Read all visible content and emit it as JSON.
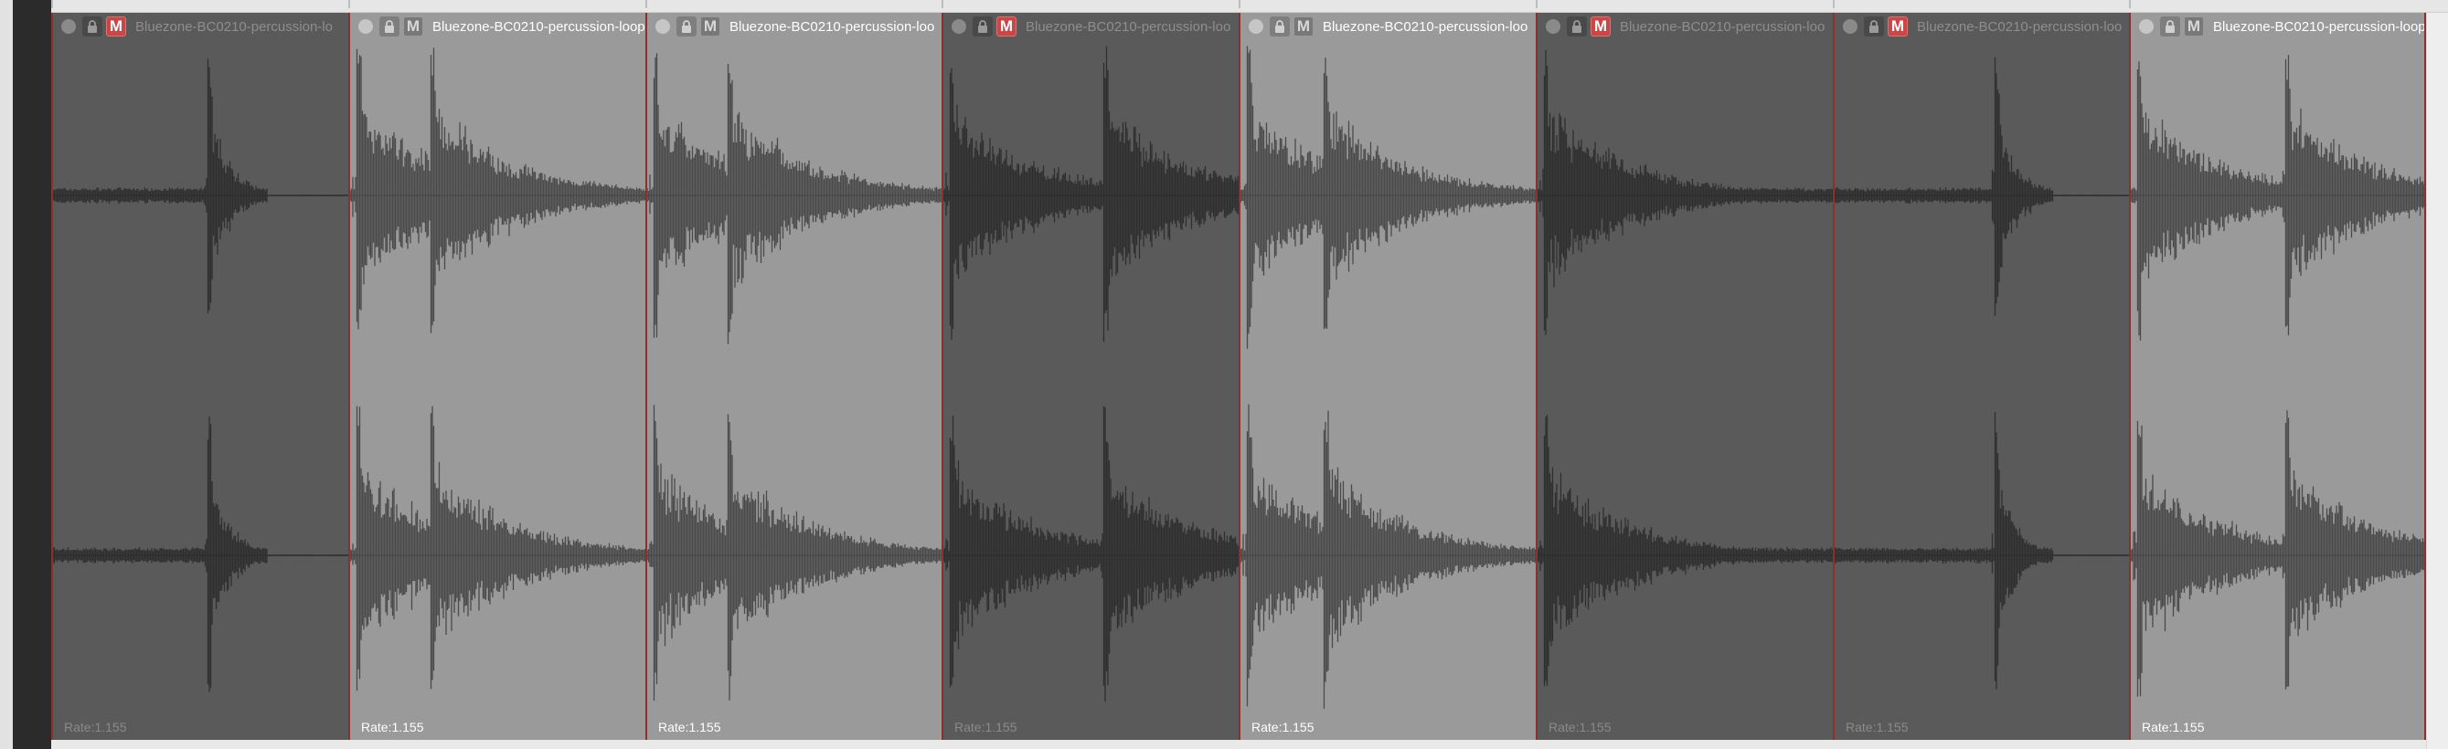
{
  "arrange": {
    "colors": {
      "item_dark_bg": "#5a5a5a",
      "item_light_bg": "#9a9a9a",
      "wave_on_dark": "#2f2f2f",
      "wave_on_light": "#4a4a4a",
      "edge_marker": "#8a3030",
      "mute_active": "#c84848"
    },
    "items": [
      {
        "title": "Bluezone-BC0210-percussion-lo",
        "rate": "Rate:1.155",
        "shade": "dark",
        "muted": true,
        "transients": [
          0.52
        ],
        "sustain": "short"
      },
      {
        "title": "Bluezone-BC0210-percussion-loop",
        "rate": "Rate:1.155",
        "shade": "light",
        "muted": false,
        "transients": [
          0.02,
          0.27
        ],
        "sustain": "long"
      },
      {
        "title": "Bluezone-BC0210-percussion-loo",
        "rate": "Rate:1.155",
        "shade": "light",
        "muted": false,
        "transients": [
          0.02,
          0.27
        ],
        "sustain": "long"
      },
      {
        "title": "Bluezone-BC0210-percussion-loo",
        "rate": "Rate:1.155",
        "shade": "dark",
        "muted": true,
        "transients": [
          0.02,
          0.54
        ],
        "sustain": "long"
      },
      {
        "title": "Bluezone-BC0210-percussion-loo",
        "rate": "Rate:1.155",
        "shade": "light",
        "muted": false,
        "transients": [
          0.02,
          0.28
        ],
        "sustain": "long"
      },
      {
        "title": "Bluezone-BC0210-percussion-loo",
        "rate": "Rate:1.155",
        "shade": "dark",
        "muted": true,
        "transients": [
          0.02
        ],
        "sustain": "long"
      },
      {
        "title": "Bluezone-BC0210-percussion-loo",
        "rate": "Rate:1.155",
        "shade": "dark",
        "muted": true,
        "transients": [
          0.54
        ],
        "sustain": "short"
      },
      {
        "title": "Bluezone-BC0210-percussion-loop-",
        "rate": "Rate:1.155",
        "shade": "light",
        "muted": false,
        "transients": [
          0.02,
          0.52
        ],
        "sustain": "long"
      }
    ]
  }
}
